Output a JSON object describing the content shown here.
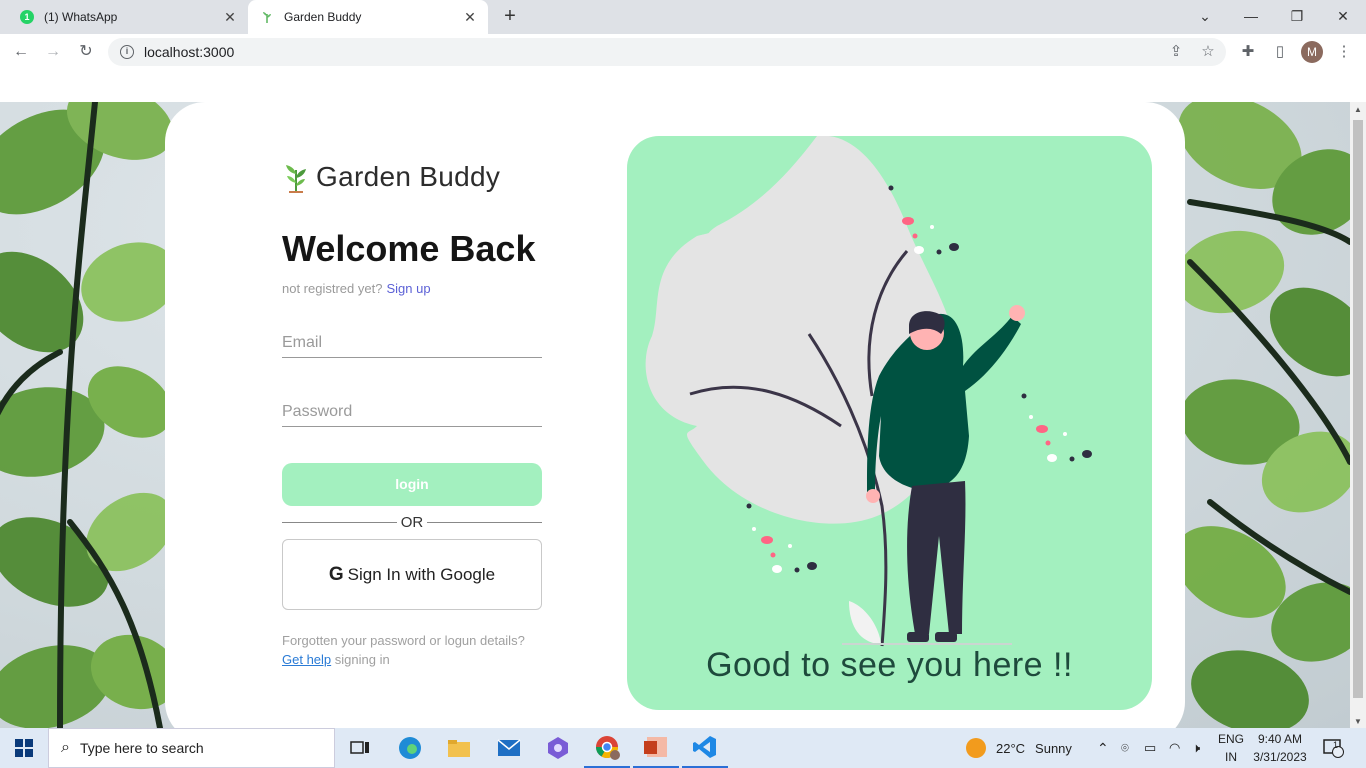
{
  "browser": {
    "tabs": [
      {
        "title": "(1) WhatsApp",
        "badge": "1"
      },
      {
        "title": "Garden Buddy"
      }
    ],
    "url": "localhost:3000",
    "profile_initial": "M"
  },
  "page": {
    "logo_text": "Garden Buddy",
    "heading": "Welcome Back",
    "signup_prompt": "not registred yet?",
    "signup_link": "Sign up",
    "email_placeholder": "Email",
    "password_placeholder": "Password",
    "login_label": "login",
    "or_label": "OR",
    "google_label": "Sign In with Google",
    "forgot_text_1": "Forgotten your password or logun details?",
    "help_link": "Get help",
    "forgot_text_2": "signing in",
    "tagline": "Good to see you here !!"
  },
  "taskbar": {
    "search_placeholder": "Type here to search",
    "weather_temp": "22°C",
    "weather_desc": "Sunny",
    "lang_1": "ENG",
    "lang_2": "IN",
    "time": "9:40 AM",
    "date": "3/31/2023",
    "notification_count": "1"
  },
  "colors": {
    "accent_green": "#a3f0bf",
    "dark_green": "#1e4a3c",
    "link_purple": "#5c61d6",
    "link_blue": "#2a7bd6"
  }
}
